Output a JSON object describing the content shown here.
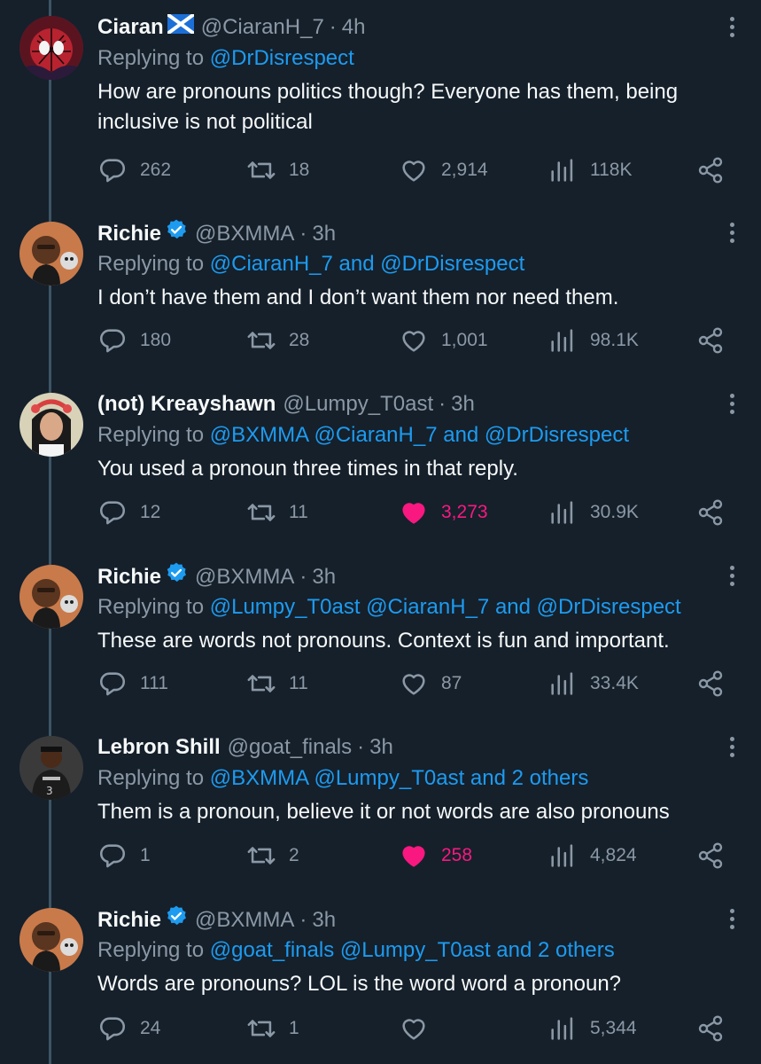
{
  "colors": {
    "background": "#15202b",
    "link": "#1d9bf0",
    "secondary_text": "#8b98a5",
    "liked": "#f91880",
    "verified": "#1d9bf0"
  },
  "icons": {
    "reply": "comment-bubble-icon",
    "retweet": "retweet-arrows-icon",
    "like": "heart-icon",
    "views": "bar-chart-icon",
    "share": "share-nodes-icon",
    "more": "vertical-dots-icon",
    "verified": "verified-badge-icon",
    "flag": "scotland-flag-icon"
  },
  "tweets": [
    {
      "name": "Ciaran",
      "handle": "@CiaranH_7",
      "dot": "·",
      "time": "4h",
      "replying_label": "Replying to",
      "replying_links": "@DrDisrespect",
      "text": "How are pronouns politics though? Everyone has them, being inclusive is not political",
      "replies": "262",
      "retweets": "18",
      "likes": "2,914",
      "views": "118K",
      "liked": false
    },
    {
      "name": "Richie",
      "handle": "@BXMMA",
      "dot": "·",
      "time": "3h",
      "replying_label": "Replying to",
      "replying_links": "@CiaranH_7 and @DrDisrespect",
      "text": "I don’t have them and I don’t want them nor need them.",
      "replies": "180",
      "retweets": "28",
      "likes": "1,001",
      "views": "98.1K",
      "liked": false
    },
    {
      "name": "(not) Kreayshawn",
      "handle": "@Lumpy_T0ast",
      "dot": "·",
      "time": "3h",
      "replying_label": "Replying to",
      "replying_links": "@BXMMA @CiaranH_7 and @DrDisrespect",
      "text": "You used a pronoun three times in that reply.",
      "replies": "12",
      "retweets": "11",
      "likes": "3,273",
      "views": "30.9K",
      "liked": true
    },
    {
      "name": "Richie",
      "handle": "@BXMMA",
      "dot": "·",
      "time": "3h",
      "replying_label": "Replying to",
      "replying_links": "@Lumpy_T0ast @CiaranH_7 and @DrDisrespect",
      "text": "These are words not pronouns. Context is fun and important.",
      "replies": "111",
      "retweets": "11",
      "likes": "87",
      "views": "33.4K",
      "liked": false
    },
    {
      "name": "Lebron Shill",
      "handle": "@goat_finals",
      "dot": "·",
      "time": "3h",
      "replying_label": "Replying to",
      "replying_links": "@BXMMA @Lumpy_T0ast and 2 others",
      "text": "Them is a pronoun, believe it or not words are also pronouns",
      "replies": "1",
      "retweets": "2",
      "likes": "258",
      "views": "4,824",
      "liked": true
    },
    {
      "name": "Richie",
      "handle": "@BXMMA",
      "dot": "·",
      "time": "3h",
      "replying_label": "Replying to",
      "replying_links": "@goat_finals @Lumpy_T0ast and 2 others",
      "text": "Words are pronouns? LOL is the word word a pronoun?",
      "replies": "24",
      "retweets": "1",
      "likes": "",
      "views": "5,344",
      "liked": false
    }
  ]
}
